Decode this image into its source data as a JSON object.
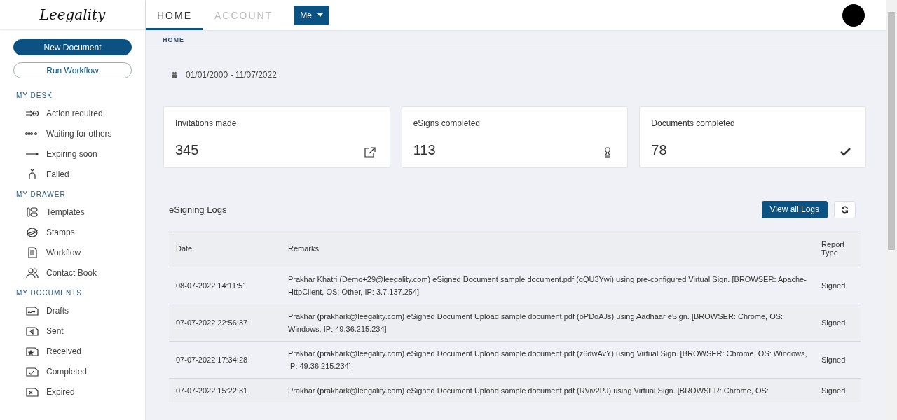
{
  "sidebar": {
    "logo": "Leegality",
    "buttons": [
      "New Document",
      "Run Workflow"
    ],
    "sections": [
      {
        "title": "MY DESK",
        "items": [
          "Action required",
          "Waiting for others",
          "Expiring soon",
          "Failed"
        ]
      },
      {
        "title": "MY DRAWER",
        "items": [
          "Templates",
          "Stamps",
          "Workflow",
          "Contact Book"
        ]
      },
      {
        "title": "MY DOCUMENTS",
        "items": [
          "Drafts",
          "Sent",
          "Received",
          "Completed",
          "Expired"
        ]
      }
    ]
  },
  "topbar": {
    "tabs": [
      {
        "label": "HOME",
        "selected": true
      },
      {
        "label": "ACCOUNT",
        "selected": false
      }
    ],
    "menu_button": "Me"
  },
  "breadcrumb": "HOME",
  "date_range": "01/01/2000 - 11/07/2022",
  "stats": [
    {
      "label": "Invitations made",
      "value": "345"
    },
    {
      "label": "eSigns completed",
      "value": "113"
    },
    {
      "label": "Documents completed",
      "value": "78"
    }
  ],
  "logs": {
    "title": "eSigning Logs",
    "view_button": "View all Logs",
    "columns": [
      "Date",
      "Remarks",
      "Report Type"
    ],
    "rows": [
      {
        "date": "08-07-2022 14:11:51",
        "remarks": "Prakhar Khatri (Demo+29@leegality.com) eSigned Document sample document.pdf (qQU3Ywi) using pre-configured Virtual Sign. [BROWSER: Apache-HttpClient, OS: Other, IP: 3.7.137.254]",
        "type": "Signed"
      },
      {
        "date": "07-07-2022 22:56:37",
        "remarks": "Prakhar (prakhark@leegality.com) eSigned Document Upload sample document.pdf (oPDoAJs) using Aadhaar eSign. [BROWSER: Chrome, OS: Windows, IP: 49.36.215.234]",
        "type": "Signed"
      },
      {
        "date": "07-07-2022 17:34:28",
        "remarks": "Prakhar (prakhark@leegality.com) eSigned Document Upload sample document.pdf (z6dwAvY) using Virtual Sign. [BROWSER: Chrome, OS: Windows, IP: 49.36.215.234]",
        "type": "Signed"
      },
      {
        "date": "07-07-2022 15:22:31",
        "remarks": "Prakhar (prakhark@leegality.com) eSigned Document Upload sample document.pdf (RViv2PJ) using Virtual Sign. [BROWSER: Chrome, OS:",
        "type": "Signed"
      }
    ]
  }
}
